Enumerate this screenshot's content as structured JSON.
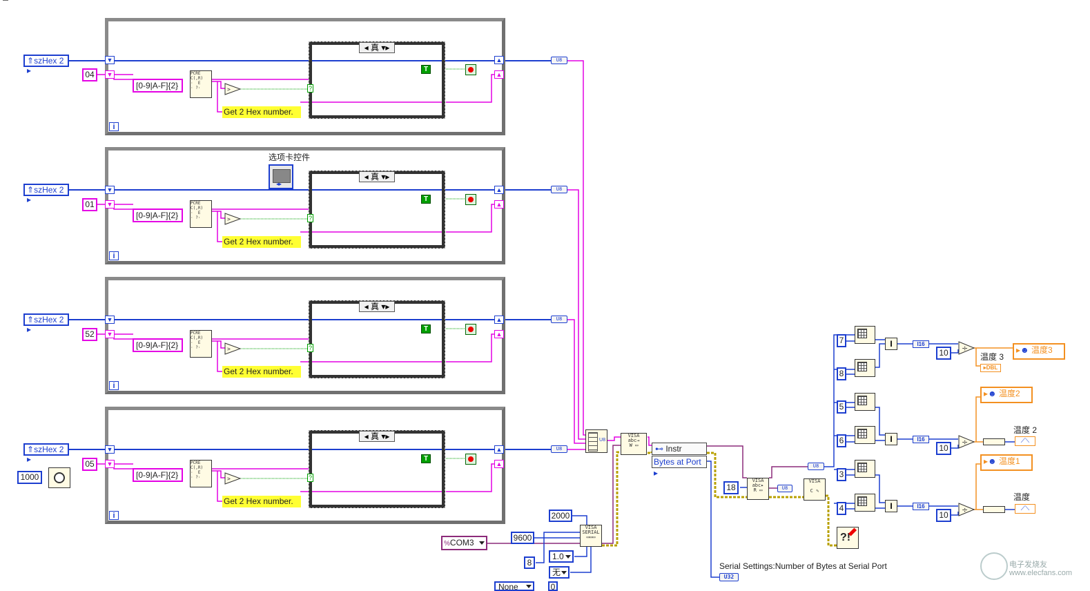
{
  "loops": [
    {
      "control_label": "szHex 2",
      "const_value": "04",
      "regex": "[0-9|A-F]{2}",
      "comment": "Get 2 Hex number.",
      "case_selector": "真",
      "t_label": "T",
      "iter_label": "i"
    },
    {
      "control_label": "szHex 2",
      "const_value": "01",
      "regex": "[0-9|A-F]{2}",
      "comment": "Get 2 Hex number.",
      "case_selector": "真",
      "t_label": "T",
      "iter_label": "i"
    },
    {
      "control_label": "szHex 2",
      "const_value": "52",
      "regex": "[0-9|A-F]{2}",
      "comment": "Get 2 Hex number.",
      "case_selector": "真",
      "t_label": "T",
      "iter_label": "i"
    },
    {
      "control_label": "szHex 2",
      "const_value": "05",
      "regex": "[0-9|A-F]{2}",
      "comment": "Get 2 Hex number.",
      "case_selector": "真",
      "t_label": "T",
      "iter_label": "i"
    }
  ],
  "tab_control_label": "选项卡控件",
  "wait_ms": "1000",
  "u8_label": "U8",
  "u32_label": "U32",
  "i16_label": "I16",
  "serial": {
    "timeout": "2000",
    "baud": "9600",
    "data_bits": "8",
    "stop_bits": "1.0",
    "parity": "无",
    "flow": "None",
    "flow_extra": "0",
    "port": "COM3"
  },
  "property_node": {
    "class": "Instr",
    "property": "Bytes at Port"
  },
  "read_count": "18",
  "serial_settings_label": "Serial Settings:Number of Bytes at Serial Port",
  "index_values": [
    "7",
    "8",
    "5",
    "6",
    "3",
    "4"
  ],
  "divisor": "10",
  "outputs": [
    {
      "local_var": "温度3",
      "indicator": "温度 3",
      "type": "DBL"
    },
    {
      "local_var": "温度2",
      "indicator": "温度 2"
    },
    {
      "local_var": "温度1",
      "indicator": "温度"
    }
  ],
  "watermark": "电子发烧友 www.elecfans.com",
  "colors": {
    "int_wire": "#1c3ecf",
    "string_wire": "#e400e4",
    "dbl_wire": "#f39020",
    "visa_wire": "#8c2a7a"
  }
}
